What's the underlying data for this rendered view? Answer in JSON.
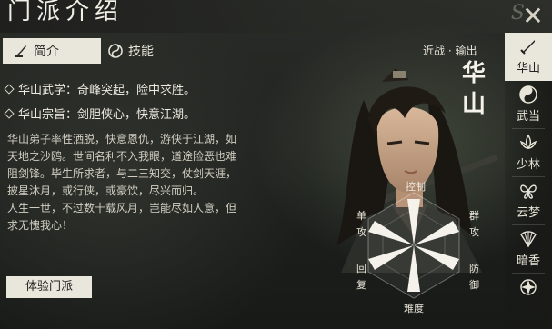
{
  "header": {
    "title": "门派介绍",
    "close_label": "✕"
  },
  "tabs": [
    {
      "label": "简介",
      "icon": "quill-icon",
      "active": true
    },
    {
      "label": "技能",
      "icon": "swirl-icon",
      "active": false
    }
  ],
  "bullets": [
    "华山武学：奇峰突起，险中求胜。",
    "华山宗旨：剑胆侠心，快意江湖。"
  ],
  "description": [
    "华山弟子率性洒脱，快意恩仇，游侠于江湖，如",
    "天地之沙鸥。世间名利不入我眼，道途险恶也难",
    "阻剑锋。毕生所求者，与二三知交，仗剑天涯，",
    "披星沐月，或行侠，或豪饮，尽兴而归。",
    "人生一世，不过数十载风月，岂能尽如人意，但",
    "求无愧我心！"
  ],
  "try_button": "体验门派",
  "character": {
    "role": "近战 · 输出",
    "name_char1": "华",
    "name_char2": "山"
  },
  "radar": {
    "axes": [
      "控制",
      "群攻",
      "防御",
      "难度",
      "回复",
      "单攻"
    ]
  },
  "sidebar": [
    {
      "label": "华山",
      "icon": "sword-icon",
      "active": true
    },
    {
      "label": "武当",
      "icon": "taiji-icon",
      "active": false
    },
    {
      "label": "少林",
      "icon": "lotus-icon",
      "active": false
    },
    {
      "label": "云梦",
      "icon": "butterfly-icon",
      "active": false
    },
    {
      "label": "暗香",
      "icon": "fan-icon",
      "active": false
    },
    {
      "label": "",
      "icon": "emblem-icon",
      "active": false
    }
  ]
}
